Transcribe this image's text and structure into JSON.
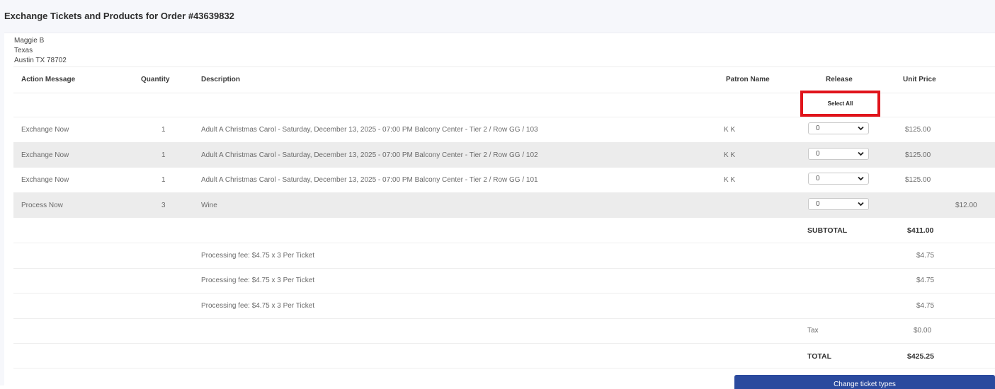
{
  "page": {
    "title": "Exchange Tickets and Products for Order #43639832"
  },
  "customer": {
    "name": "Maggie B",
    "state": "Texas",
    "city_line": "Austin TX 78702"
  },
  "table": {
    "headers": {
      "action": "Action Message",
      "quantity": "Quantity",
      "description": "Description",
      "patron": "Patron Name",
      "release": "Release",
      "unit_price": "Unit Price"
    },
    "select_all_label": "Select All",
    "rows": [
      {
        "action": "Exchange Now",
        "quantity": "1",
        "description": "Adult A Christmas Carol - Saturday, December 13, 2025 - 07:00 PM Balcony Center - Tier 2 / Row GG / 103",
        "patron": "K K",
        "release": "0",
        "unit_price": "$125.00"
      },
      {
        "action": "Exchange Now",
        "quantity": "1",
        "description": "Adult A Christmas Carol - Saturday, December 13, 2025 - 07:00 PM Balcony Center - Tier 2 / Row GG / 102",
        "patron": "K K",
        "release": "0",
        "unit_price": "$125.00"
      },
      {
        "action": "Exchange Now",
        "quantity": "1",
        "description": "Adult A Christmas Carol - Saturday, December 13, 2025 - 07:00 PM Balcony Center - Tier 2 / Row GG / 101",
        "patron": "K K",
        "release": "0",
        "unit_price": "$125.00"
      },
      {
        "action": "Process Now",
        "quantity": "3",
        "description": "Wine",
        "patron": "",
        "release": "0",
        "unit_price": "$12.00"
      }
    ],
    "subtotal": {
      "label": "SUBTOTAL",
      "value": "$411.00"
    },
    "fees": [
      {
        "description": "Processing fee: $4.75 x 3 Per Ticket",
        "value": "$4.75"
      },
      {
        "description": "Processing fee: $4.75 x 3 Per Ticket",
        "value": "$4.75"
      },
      {
        "description": "Processing fee: $4.75 x 3 Per Ticket",
        "value": "$4.75"
      }
    ],
    "tax": {
      "label": "Tax",
      "value": "$0.00"
    },
    "total": {
      "label": "TOTAL",
      "value": "$425.25"
    }
  },
  "actions": {
    "change_ticket_types": "Change ticket types"
  },
  "colors": {
    "highlight": "#e0141b",
    "button": "#2b4a9e",
    "shaded_row": "#ececec"
  }
}
